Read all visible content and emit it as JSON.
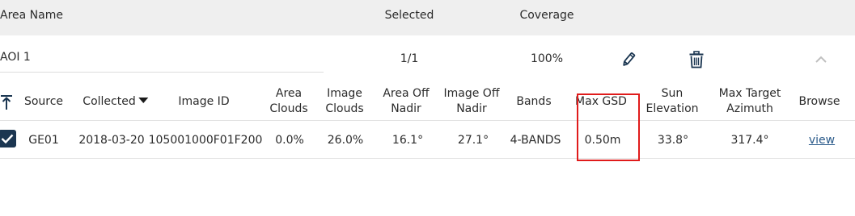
{
  "header": {
    "area_name": "Area Name",
    "selected": "Selected",
    "coverage": "Coverage"
  },
  "aoi": {
    "name": "AOI 1",
    "selected": "1/1",
    "coverage": "100%",
    "icons": [
      "pencil-icon",
      "trash-icon",
      "chevron-up-icon"
    ]
  },
  "columns": {
    "sort_icon": "sort-up-icon",
    "source": "Source",
    "collected": "Collected",
    "collected_sort": "descending",
    "image_id": "Image ID",
    "area_clouds": [
      "Area",
      "Clouds"
    ],
    "image_clouds": [
      "Image",
      "Clouds"
    ],
    "area_off_nadir": [
      "Area Off",
      "Nadir"
    ],
    "image_off_nadir": [
      "Image Off",
      "Nadir"
    ],
    "bands": "Bands",
    "max_gsd": "Max GSD",
    "sun_elevation": [
      "Sun",
      "Elevation"
    ],
    "max_target_azimuth": [
      "Max Target",
      "Azimuth"
    ],
    "browse": "Browse"
  },
  "rows": [
    {
      "checked": true,
      "source": "GE01",
      "collected": "2018-03-20",
      "image_id": "105001000F01F200",
      "area_clouds": "0.0%",
      "image_clouds": "26.0%",
      "area_off_nadir": "16.1°",
      "image_off_nadir": "27.1°",
      "bands": "4-BANDS",
      "max_gsd": "0.50m",
      "sun_elevation": "33.8°",
      "max_target_azimuth": "317.4°",
      "browse": "view"
    }
  ],
  "colors": {
    "header_bg": "#efefef",
    "checkbox": "#1b3651",
    "icon": "#1b3651",
    "highlight": "#e01b1b",
    "link": "#2a5a8a"
  }
}
